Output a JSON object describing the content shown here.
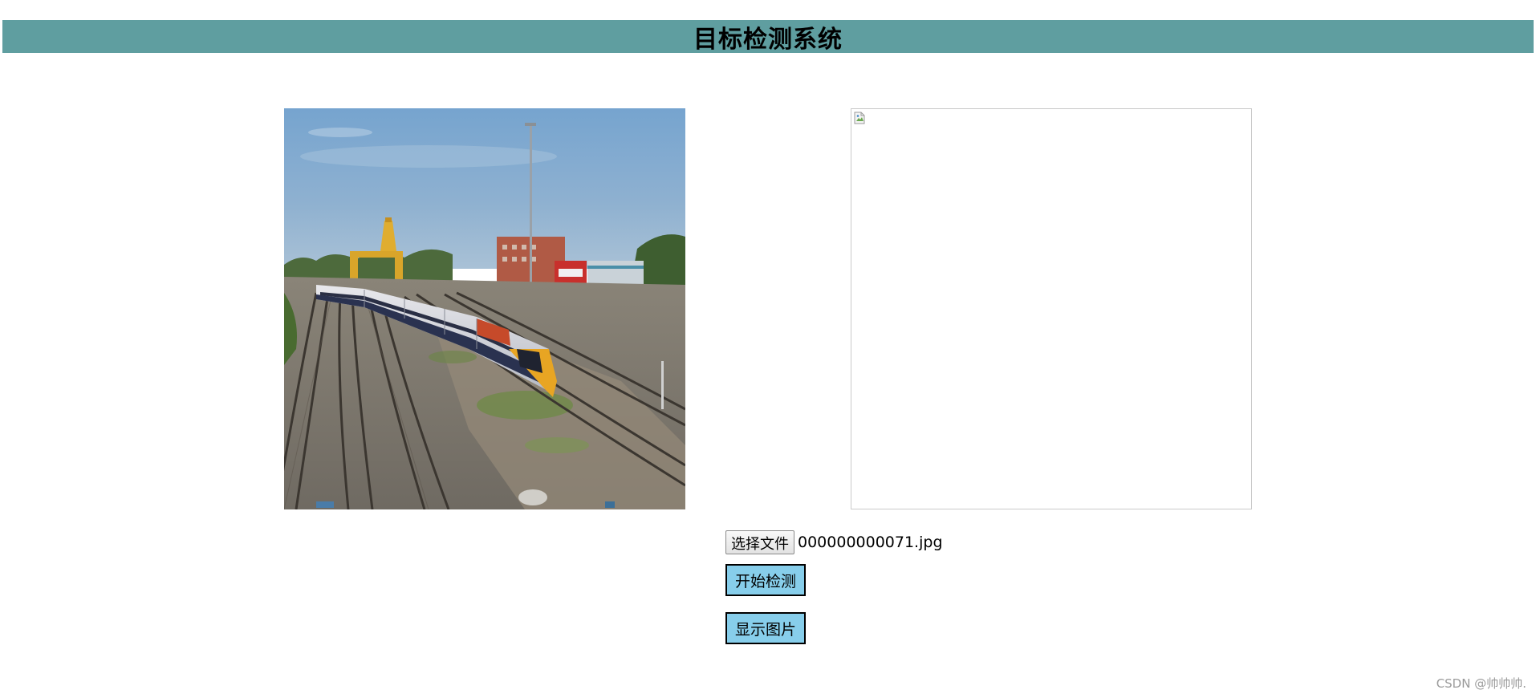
{
  "header": {
    "title": "目标检测系统"
  },
  "input_image": {
    "alt": "input image - train on railway tracks"
  },
  "output_image": {
    "state": "empty"
  },
  "file_input": {
    "button_label": "选择文件",
    "file_name": "000000000071.jpg"
  },
  "buttons": {
    "detect_label": "开始检测",
    "show_label": "显示图片"
  },
  "watermark": {
    "text": "CSDN @帅帅帅."
  },
  "colors": {
    "header_bg": "#5f9ea0",
    "button_bg": "#87ceeb"
  }
}
